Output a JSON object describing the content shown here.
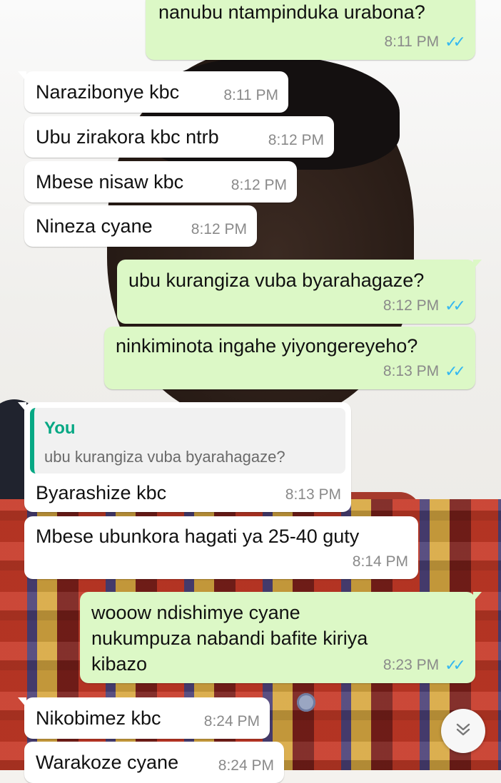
{
  "messages": [
    {
      "text": "nanubu ntampinduka urabona?",
      "time": "8:11 PM"
    },
    {
      "text": "Narazibonye kbc",
      "time": "8:11 PM"
    },
    {
      "text": "Ubu zirakora kbc ntrb",
      "time": "8:12 PM"
    },
    {
      "text": "Mbese nisaw kbc",
      "time": "8:12 PM"
    },
    {
      "text": "Nineza cyane",
      "time": "8:12 PM"
    },
    {
      "text": "ubu kurangiza vuba byarahagaze?",
      "time": "8:12 PM"
    },
    {
      "text": "ninkiminota ingahe yiyongereyeho?",
      "time": "8:13 PM"
    },
    {
      "text": "Byarashize kbc",
      "time": "8:13 PM",
      "quote": {
        "author": "You",
        "text": "ubu kurangiza vuba byarahagaze?"
      }
    },
    {
      "text": "Mbese ubunkora hagati ya 25-40 guty",
      "time": "8:14 PM"
    },
    {
      "lines": [
        "wooow ndishimye cyane",
        "nukumpuza nabandi bafite kiriya",
        "kibazo"
      ],
      "time": "8:23 PM"
    },
    {
      "text": "Nikobimez kbc",
      "time": "8:24 PM"
    },
    {
      "text": "Warakoze cyane",
      "time": "8:24 PM"
    }
  ],
  "ticks_glyph": "✓✓",
  "scroll_icon": "chevron-double-down-icon",
  "colors": {
    "incoming": "#ffffff",
    "outgoing": "#dcf8c6",
    "read_ticks": "#34b7f1",
    "quote_accent": "#06a884"
  }
}
